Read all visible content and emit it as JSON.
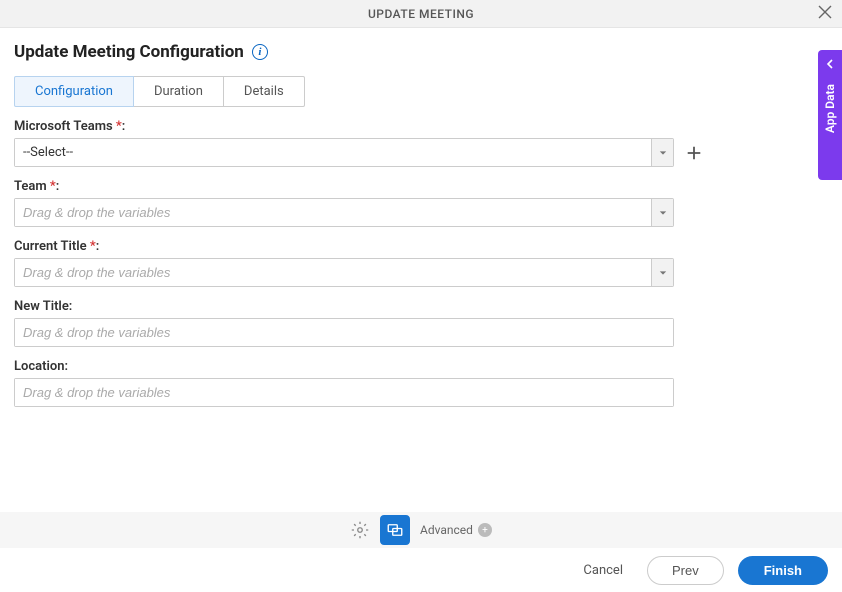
{
  "titleBar": {
    "title": "UPDATE MEETING"
  },
  "pageTitle": "Update Meeting Configuration",
  "tabs": [
    {
      "label": "Configuration",
      "active": true
    },
    {
      "label": "Duration",
      "active": false
    },
    {
      "label": "Details",
      "active": false
    }
  ],
  "fields": {
    "msTeams": {
      "label": "Microsoft Teams ",
      "required": "*",
      "colon": ":",
      "value": "--Select--"
    },
    "team": {
      "label": "Team ",
      "required": "*",
      "colon": ":",
      "placeholder": "Drag & drop the variables"
    },
    "currentTitle": {
      "label": "Current Title ",
      "required": "*",
      "colon": ":",
      "placeholder": "Drag & drop the variables"
    },
    "newTitle": {
      "label": "New Title:",
      "placeholder": "Drag & drop the variables"
    },
    "location": {
      "label": "Location:",
      "placeholder": "Drag & drop the variables"
    }
  },
  "bottomToolbar": {
    "advancedLabel": "Advanced"
  },
  "footer": {
    "cancel": "Cancel",
    "prev": "Prev",
    "finish": "Finish"
  },
  "sideTab": {
    "label": "App Data"
  }
}
